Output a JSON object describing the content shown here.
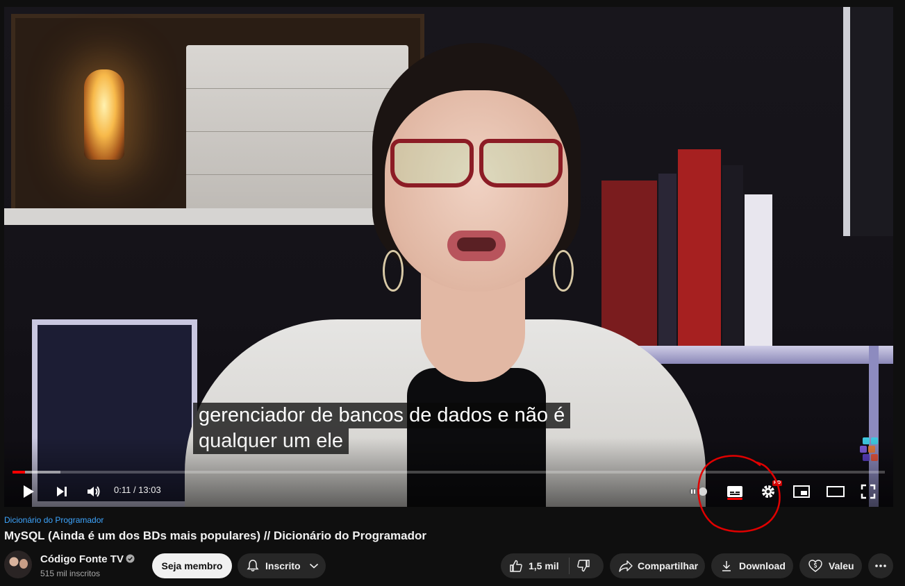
{
  "player": {
    "subtitle_lines": [
      "gerenciador de bancos de dados e não é",
      "qualquer um ele"
    ],
    "time_display": "0:11 / 13:03",
    "progress_played_fraction": 0.014,
    "progress_buffered_fraction": 0.055,
    "hd_badge": "HD",
    "controls": [
      "play-icon",
      "next-icon",
      "volume-icon",
      "autoplay-toggle",
      "subtitles-icon",
      "settings-gear-icon",
      "miniplayer-icon",
      "theater-mode-icon",
      "fullscreen-icon"
    ],
    "accent_color": "#ff0000",
    "annotation_color": "#e00000"
  },
  "video": {
    "playlist_label": "Dicionário do Programador",
    "title": "MySQL (Ainda é um dos BDs mais populares) // Dicionário do Programador"
  },
  "channel": {
    "name": "Código Fonte TV",
    "subscribers": "515 mil inscritos"
  },
  "actions": {
    "join_label": "Seja membro",
    "subscribed_label": "Inscrito",
    "likes": "1,5 mil",
    "share_label": "Compartilhar",
    "download_label": "Download",
    "thanks_label": "Valeu"
  }
}
